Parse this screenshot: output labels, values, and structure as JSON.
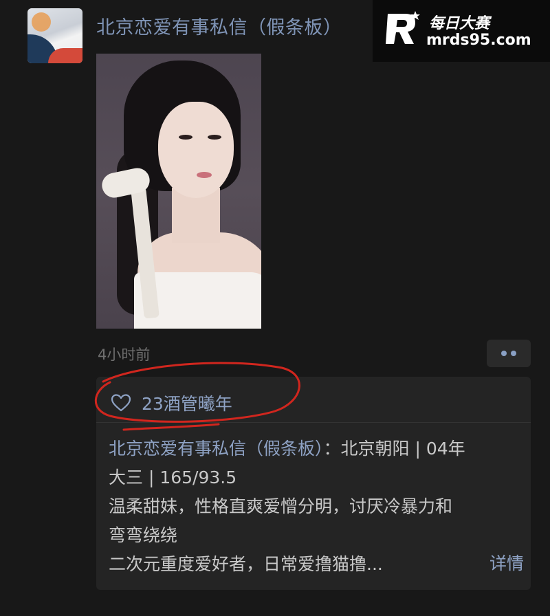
{
  "header": {
    "title": "北京恋爱有事私信（假条板）"
  },
  "watermark": {
    "brand_cn": "每日大赛",
    "brand_url": "mrds95.com"
  },
  "post": {
    "time": "4小时前",
    "likes": "23酒管曦年",
    "author": "北京恋爱有事私信（假条板）",
    "text_line1_rest": "：北京朝阳 | 04年",
    "text_line2": "大三 | 165/93.5",
    "text_line3": "温柔甜妹，性格直爽爱憎分明，讨厌冷暴力和",
    "text_line4": "弯弯绕绕",
    "text_line5": "二次元重度爱好者，日常爱撸猫撸...",
    "detail_label": "详情"
  },
  "icons": {
    "avatar": "avatar-image",
    "more": "more-dots-icon",
    "like": "heart-outline-icon"
  },
  "colors": {
    "background": "#181818",
    "accent_link": "#8ea2c4",
    "annotation_red": "#d1261e"
  }
}
